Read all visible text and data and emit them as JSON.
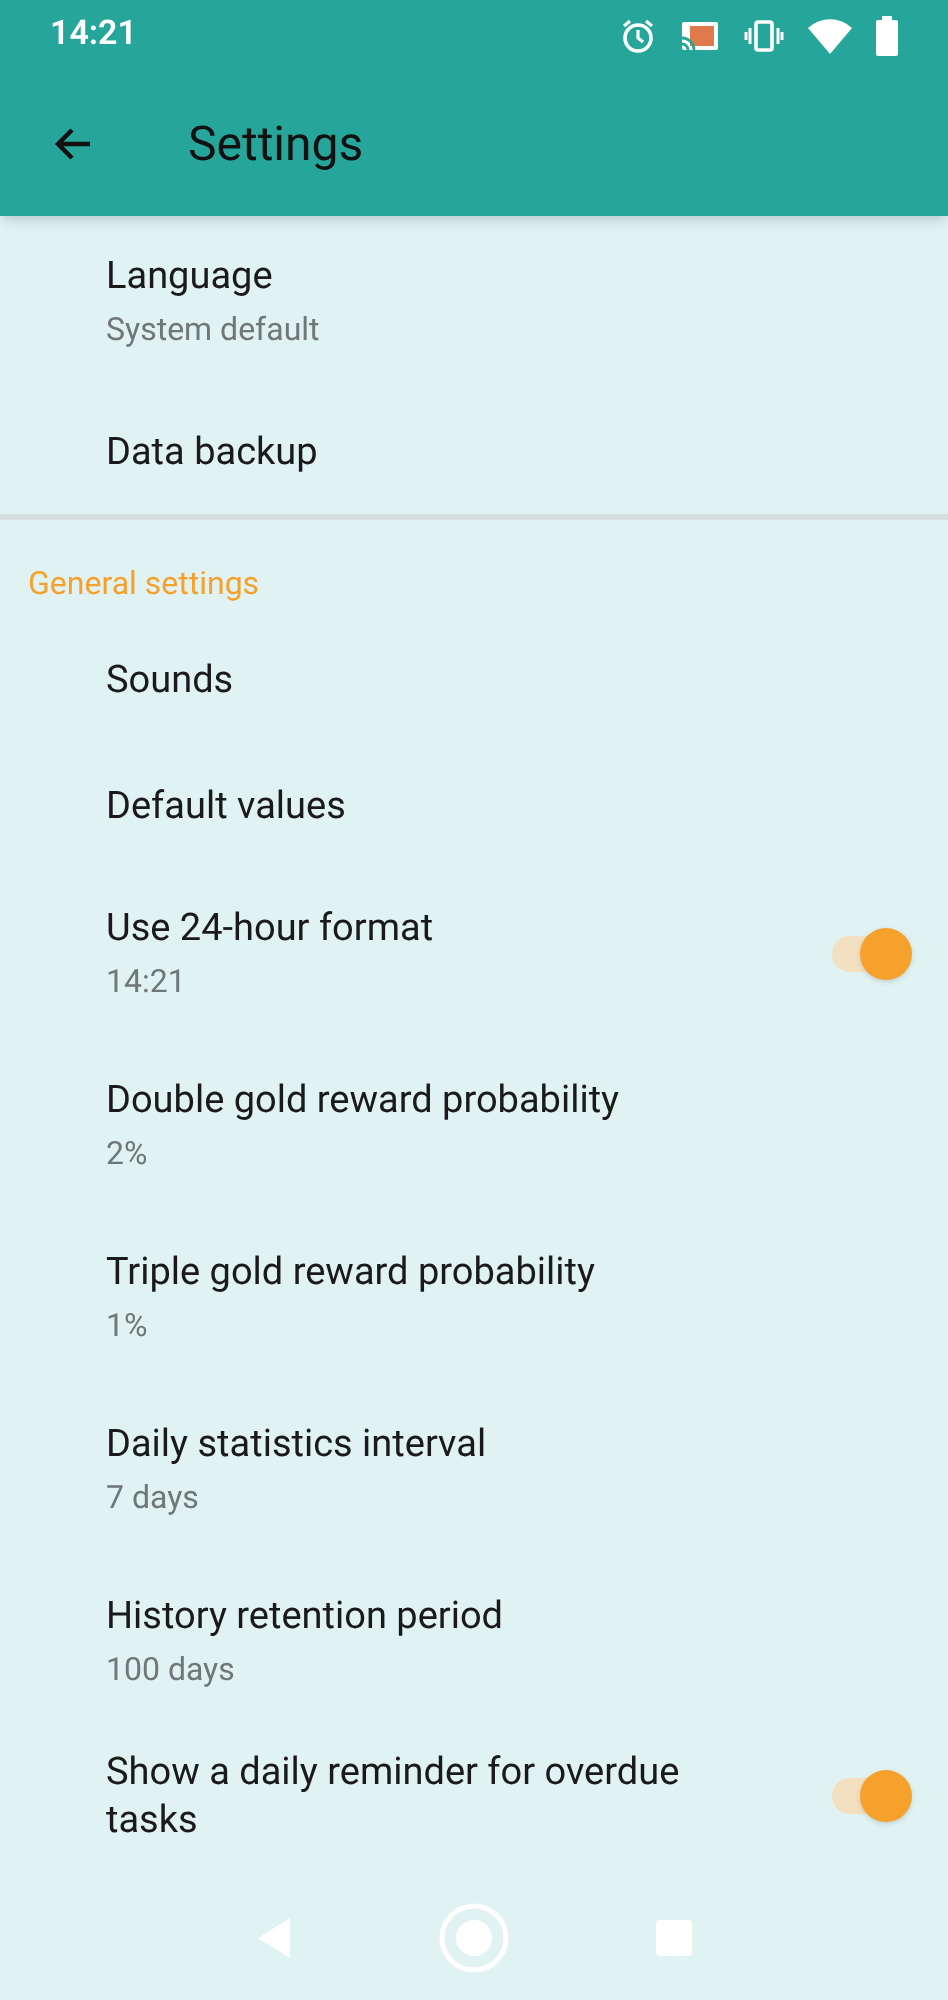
{
  "status_bar": {
    "time": "14:21"
  },
  "toolbar": {
    "title": "Settings"
  },
  "sections": [
    {
      "items": [
        {
          "kind": "text",
          "title": "Language",
          "summary": "System default"
        },
        {
          "kind": "text",
          "title": "Data backup"
        }
      ]
    },
    {
      "header": "General settings",
      "items": [
        {
          "kind": "text",
          "title": "Sounds"
        },
        {
          "kind": "text",
          "title": "Default values"
        },
        {
          "kind": "switch",
          "title": "Use 24-hour format",
          "summary": "14:21",
          "on": true
        },
        {
          "kind": "text",
          "title": "Double gold reward probability",
          "summary": "2%"
        },
        {
          "kind": "text",
          "title": "Triple gold reward probability",
          "summary": "1%"
        },
        {
          "kind": "text",
          "title": "Daily statistics interval",
          "summary": "7 days"
        },
        {
          "kind": "text",
          "title": "History retention period",
          "summary": "100 days"
        },
        {
          "kind": "switch",
          "title": "Show a daily reminder for overdue tasks",
          "on": true
        }
      ]
    }
  ]
}
